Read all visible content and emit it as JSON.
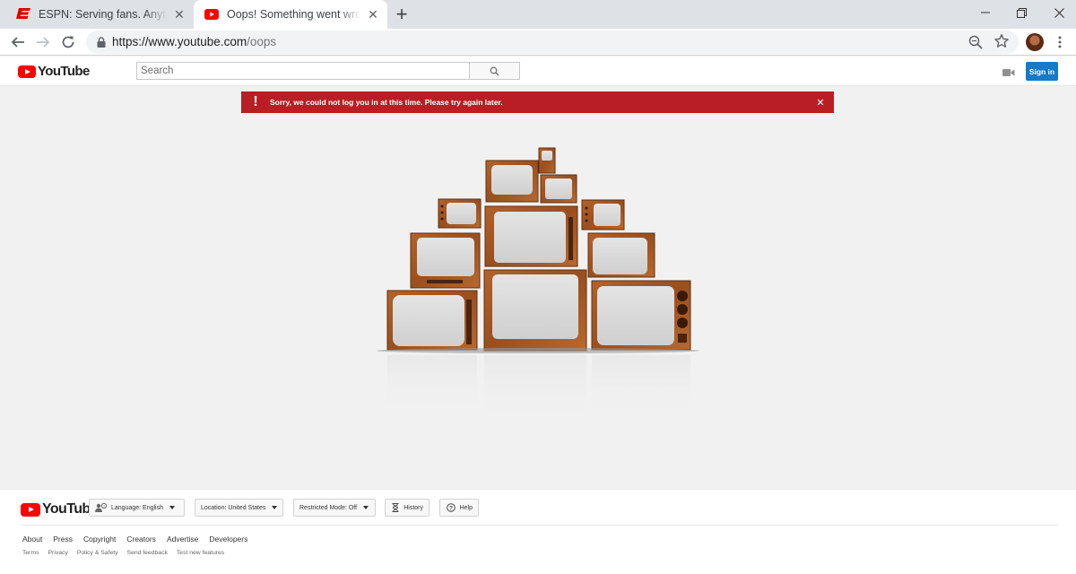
{
  "browser": {
    "tabs": [
      {
        "title": "ESPN: Serving fans. Anytime. Anywhere.",
        "icon": "espn-logo-icon",
        "active": false
      },
      {
        "title": "Oops! Something went wrong. - YouTube",
        "icon": "youtube-logo-icon",
        "active": true
      }
    ],
    "url_host": "https://www.youtube.com",
    "url_path": "/oops"
  },
  "youtube": {
    "logo_text": "YouTube",
    "search_placeholder": "Search",
    "signin_label": "Sign in",
    "brand_red": "#ff0000",
    "accent_blue": "#167ac6"
  },
  "alert": {
    "message": "Sorry, we could not log you in at this time. Please try again later.",
    "color": "#b81e23"
  },
  "footer": {
    "logo_text": "YouTube",
    "language": "Language: English",
    "location": "Location: United States",
    "restricted": "Restricted Mode: Off",
    "history": "History",
    "help": "Help",
    "links": [
      "About",
      "Press",
      "Copyright",
      "Creators",
      "Advertise",
      "Developers"
    ],
    "sub_links": [
      "Terms",
      "Privacy",
      "Policy & Safety",
      "Send feedback",
      "Test new features"
    ]
  }
}
